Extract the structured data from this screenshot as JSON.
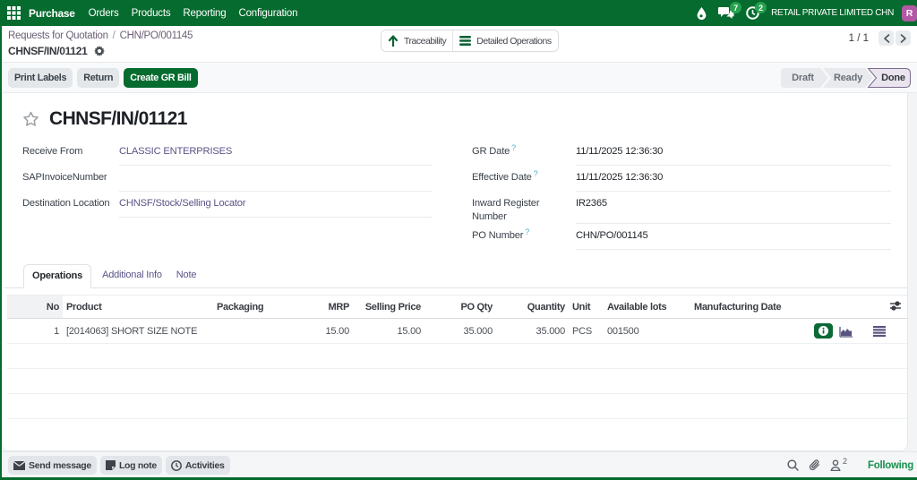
{
  "topbar": {
    "app_name": "Purchase",
    "menus": [
      "Orders",
      "Products",
      "Reporting",
      "Configuration"
    ],
    "messages_badge": "7",
    "activities_badge": "2",
    "company": "RETAIL PRIVATE LIMITED CHN",
    "avatar_initial": "R"
  },
  "breadcrumb": {
    "parent": "Requests for Quotation",
    "separator": "/",
    "current": "CHN/PO/001145",
    "record": "CHNSF/IN/01121"
  },
  "view_buttons": {
    "traceability": "Traceability",
    "detailed_operations": "Detailed Operations"
  },
  "pager": {
    "count": "1 / 1"
  },
  "statusbar": {
    "print_labels": "Print Labels",
    "return": "Return",
    "create_gr_bill": "Create GR Bill",
    "states": {
      "draft": "Draft",
      "ready": "Ready",
      "done": "Done"
    },
    "active_state": "Done"
  },
  "form": {
    "title": "CHNSF/IN/01121",
    "fields_left": [
      {
        "label": "Receive From",
        "value": "CLASSIC ENTERPRISES"
      },
      {
        "label": "SAPInvoiceNumber",
        "value": ""
      },
      {
        "label": "Destination Location",
        "value": "CHNSF/Stock/Selling Locator"
      }
    ],
    "fields_right": [
      {
        "label": "GR Date",
        "help": "?",
        "value": "11/11/2025 12:36:30"
      },
      {
        "label": "Effective Date",
        "help": "?",
        "value": "11/11/2025 12:36:30"
      },
      {
        "label": "Inward Register Number",
        "help": "",
        "value": "IR2365"
      },
      {
        "label": "PO Number",
        "help": "?",
        "value": "CHN/PO/001145"
      }
    ]
  },
  "tabs": [
    "Operations",
    "Additional Info",
    "Note"
  ],
  "table": {
    "headers": [
      "No",
      "Product",
      "Packaging",
      "MRP",
      "Selling Price",
      "PO Qty",
      "Quantity",
      "Unit",
      "Available lots",
      "Manufacturing Date"
    ],
    "rows": [
      {
        "no": "1",
        "product": "[2014063] SHORT SIZE NOTE",
        "packaging": "",
        "mrp": "15.00",
        "selling_price": "15.00",
        "po_qty": "35.000",
        "quantity": "35.000",
        "unit": "PCS",
        "available_lots": "001500",
        "manufacturing_date": ""
      }
    ]
  },
  "chatter": {
    "send_message": "Send message",
    "log_note": "Log note",
    "activities": "Activities",
    "followers_count": "2",
    "following": "Following"
  },
  "colors": {
    "brand_green": "#056b2e",
    "badge_green": "#26a14e",
    "link_violet": "#5a5488",
    "done_border": "#7d6b8e",
    "avatar_magenta": "#b358a4"
  }
}
